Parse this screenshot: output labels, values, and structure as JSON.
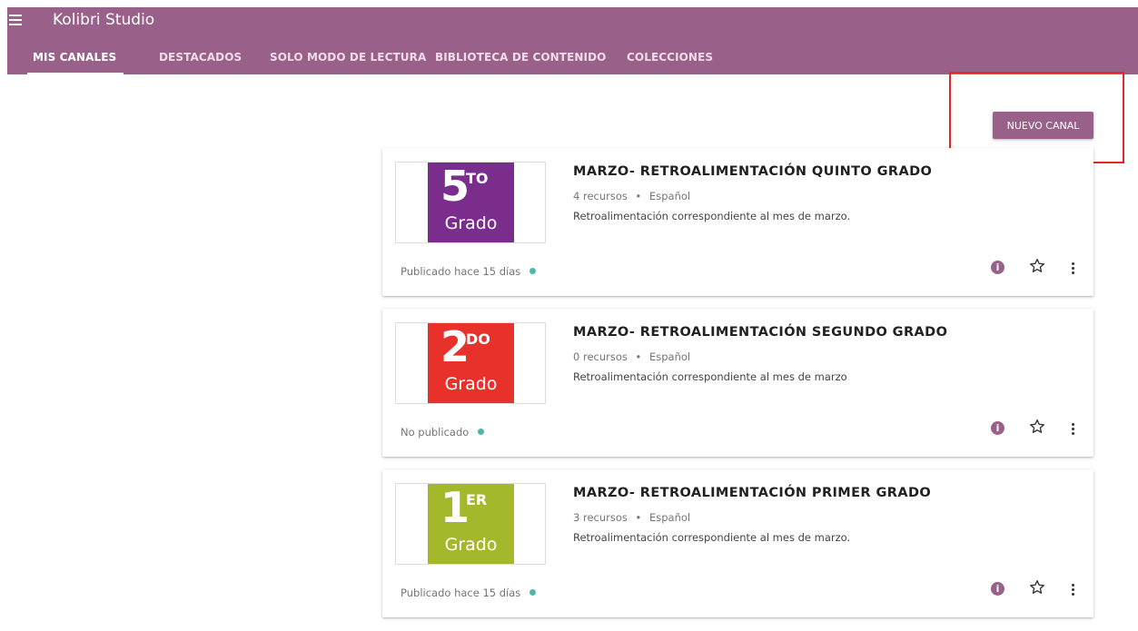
{
  "app": {
    "title": "Kolibri Studio"
  },
  "tabs": [
    {
      "label": "MIS CANALES",
      "active": true
    },
    {
      "label": "DESTACADOS"
    },
    {
      "label": "SOLO MODO DE LECTURA"
    },
    {
      "label": "BIBLIOTECA DE CONTENIDO"
    },
    {
      "label": "COLECCIONES"
    }
  ],
  "actions": {
    "new_channel_label": "NUEVO CANAL"
  },
  "channels": [
    {
      "title": "MARZO- RETROALIMENTACIÓN QUINTO GRADO",
      "resources": "4 recursos",
      "separator": "•",
      "language": "Español",
      "description": "Retroalimentación correspondiente al mes de marzo.",
      "status": "Publicado hace 15 días",
      "thumbnail": {
        "number": "5",
        "superscript": "TO",
        "word": "Grado",
        "color": "#7b2d8e"
      }
    },
    {
      "title": "MARZO- RETROALIMENTACIÓN SEGUNDO GRADO",
      "resources": "0 recursos",
      "separator": "•",
      "language": "Español",
      "description": "Retroalimentación correspondiente al mes de marzo",
      "status": "No publicado",
      "thumbnail": {
        "number": "2",
        "superscript": "DO",
        "word": "Grado",
        "color": "#e8312a"
      }
    },
    {
      "title": "MARZO- RETROALIMENTACIÓN PRIMER GRADO",
      "resources": "3 recursos",
      "separator": "•",
      "language": "Español",
      "description": "Retroalimentación correspondiente al mes de marzo.",
      "status": "Publicado hace 15 días",
      "thumbnail": {
        "number": "1",
        "superscript": "ER",
        "word": "Grado",
        "color": "#a5b82c"
      }
    }
  ],
  "icons": {
    "menu": "menu-icon",
    "info": "info-icon",
    "star": "star-outline-icon",
    "more": "more-vert-icon"
  },
  "colors": {
    "primary": "#996189",
    "status_dot": "#4db6ac",
    "highlight": "#e52727"
  }
}
